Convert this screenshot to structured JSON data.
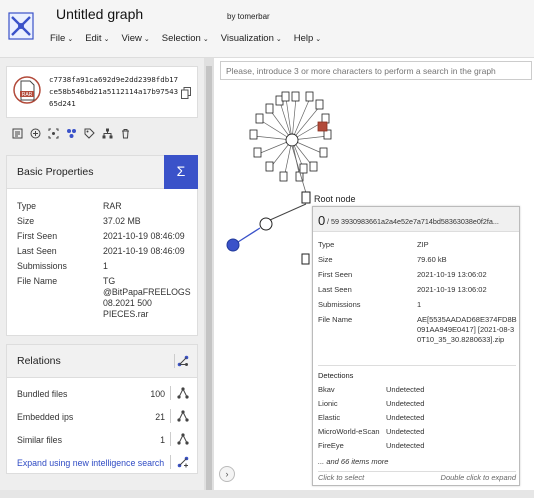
{
  "header": {
    "title": "Untitled graph",
    "byline": "by tomerbar",
    "menu": [
      {
        "label": "File"
      },
      {
        "label": "Edit"
      },
      {
        "label": "View"
      },
      {
        "label": "Selection"
      },
      {
        "label": "Visualization"
      },
      {
        "label": "Help"
      }
    ]
  },
  "file": {
    "hash": "c7738fa91ca692d9e2dd2398fdb17ce58b546bd21a5112114a17b9754365d241",
    "type_badge": "RAR"
  },
  "toolbar_icons": [
    "summary-icon",
    "add-icon",
    "expand-icon",
    "cluster-icon",
    "tag-icon",
    "hierarchy-icon",
    "delete-icon"
  ],
  "basic_properties": {
    "title": "Basic Properties",
    "sigma_label": "Σ",
    "rows": [
      {
        "key": "Type",
        "value": "RAR"
      },
      {
        "key": "Size",
        "value": "37.02 MB"
      },
      {
        "key": "First Seen",
        "value": "2021-10-19 08:46:09"
      },
      {
        "key": "Last Seen",
        "value": "2021-10-19 08:46:09"
      },
      {
        "key": "Submissions",
        "value": "1"
      },
      {
        "key": "File Name",
        "value": "TG @BitPapaFREELOGS 08.2021 500 PIECES.rar"
      }
    ]
  },
  "relations": {
    "title": "Relations",
    "rows": [
      {
        "label": "Bundled files",
        "count": "100"
      },
      {
        "label": "Embedded ips",
        "count": "21"
      },
      {
        "label": "Similar files",
        "count": "1"
      }
    ],
    "expand_link": "Expand using new intelligence search"
  },
  "graph": {
    "search_placeholder": "Please, introduce 3 or more characters to perform a search in the graph",
    "root_label": "Root node"
  },
  "popup": {
    "score_main": "0",
    "score_rest": "/ 59  3930983661a2a4e52e7a714bd58363038e0f2fa...",
    "rows": [
      {
        "key": "Type",
        "value": "ZIP"
      },
      {
        "key": "Size",
        "value": "79.60 kB"
      },
      {
        "key": "First Seen",
        "value": "2021-10-19 13:06:02"
      },
      {
        "key": "Last Seen",
        "value": "2021-10-19 13:06:02"
      },
      {
        "key": "Submissions",
        "value": "1"
      },
      {
        "key": "File Name",
        "value": "AE[5535AADAD68E374FD8B091AA949E0417] [2021-08-30T10_35_30.8280633].zip"
      }
    ],
    "detections_title": "Detections",
    "detections": [
      {
        "engine": "Bkav",
        "result": "Undetected"
      },
      {
        "engine": "Lionic",
        "result": "Undetected"
      },
      {
        "engine": "Elastic",
        "result": "Undetected"
      },
      {
        "engine": "MicroWorld-eScan",
        "result": "Undetected"
      },
      {
        "engine": "FireEye",
        "result": "Undetected"
      }
    ],
    "more": "... and 66 items more",
    "footer_left": "Click to select",
    "footer_right": "Double click to expand"
  },
  "colors": {
    "accent": "#3a52c9",
    "link": "#2f4bc4",
    "rar_badge": "#b24a3a"
  }
}
